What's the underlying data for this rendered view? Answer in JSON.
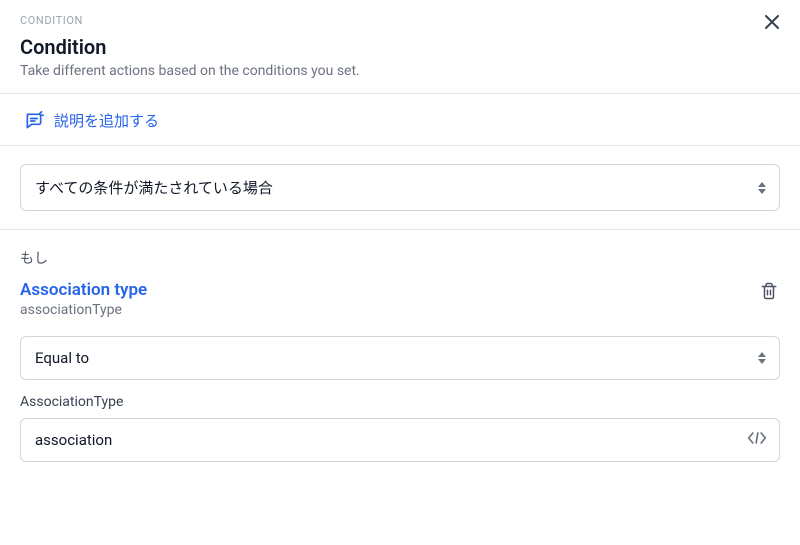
{
  "header": {
    "overline": "CONDITION",
    "title": "Condition",
    "subtitle": "Take different actions based on the conditions you set."
  },
  "addDescription": {
    "label": "説明を追加する"
  },
  "matchMode": {
    "selected": "すべての条件が満たされている場合"
  },
  "condition": {
    "if_label": "もし",
    "field_display": "Association type",
    "field_key": "associationType",
    "operator_selected": "Equal to",
    "value_label": "AssociationType",
    "value": "association"
  }
}
